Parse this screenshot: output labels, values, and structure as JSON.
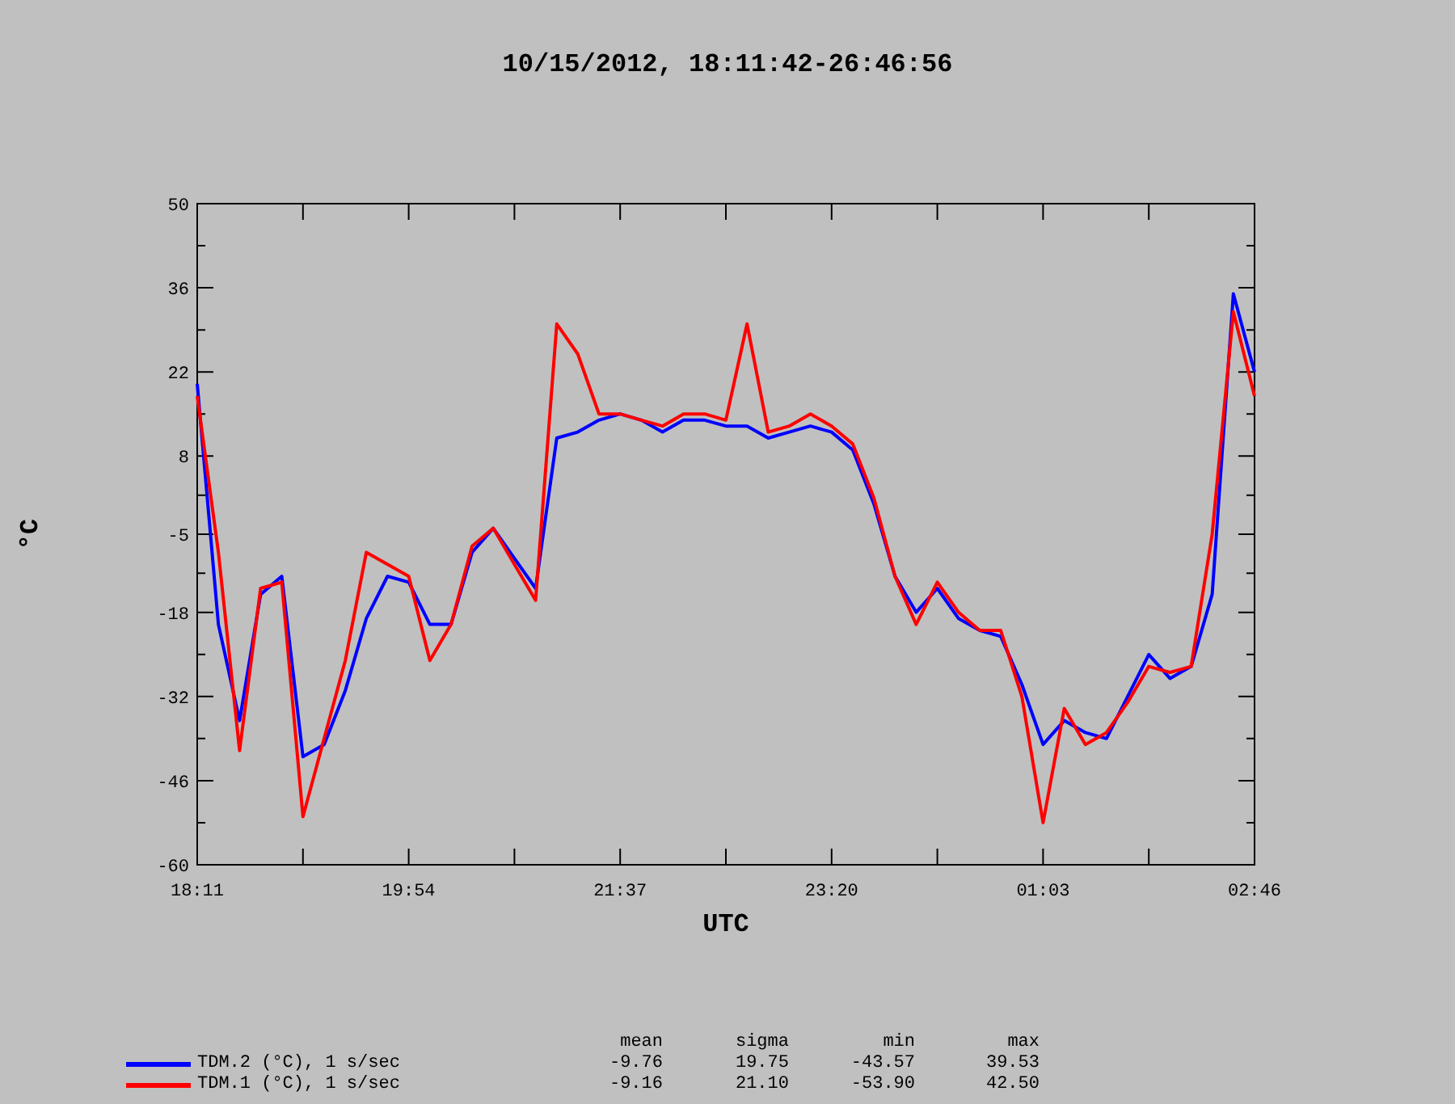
{
  "title": "10/15/2012, 18:11:42-26:46:56",
  "chart_data": {
    "type": "line",
    "xlabel": "UTC",
    "ylabel": "°C",
    "ylim": [
      -60,
      50
    ],
    "yticks": [
      -60,
      -46,
      -32,
      -18,
      -5,
      8,
      22,
      36,
      50
    ],
    "categories": [
      "18:11",
      null,
      null,
      null,
      null,
      null,
      null,
      null,
      null,
      null,
      "19:54",
      null,
      null,
      null,
      null,
      null,
      null,
      null,
      null,
      null,
      "21:37",
      null,
      null,
      null,
      null,
      null,
      null,
      null,
      null,
      null,
      "23:20",
      null,
      null,
      null,
      null,
      null,
      null,
      null,
      null,
      null,
      "01:03",
      null,
      null,
      null,
      null,
      null,
      null,
      null,
      null,
      null,
      "02:46"
    ],
    "series": [
      {
        "name": "TDM.2 (°C), 1 s/sec",
        "color": "#0000ff",
        "values": [
          20,
          -20,
          -36,
          -15,
          -12,
          -42,
          -40,
          -31,
          -19,
          -12,
          -13,
          -20,
          -20,
          -8,
          -4,
          -9,
          -14,
          11,
          12,
          14,
          15,
          14,
          12,
          14,
          14,
          13,
          13,
          11,
          12,
          13,
          12,
          9,
          0,
          -12,
          -18,
          -14,
          -19,
          -21,
          -22,
          -30,
          -40,
          -36,
          -38,
          -39,
          -32,
          -25,
          -29,
          -27,
          -15,
          35,
          22
        ]
      },
      {
        "name": "TDM.1 (°C), 1 s/sec",
        "color": "#ff0000",
        "values": [
          18,
          -8,
          -41,
          -14,
          -13,
          -52,
          -39,
          -26,
          -8,
          -10,
          -12,
          -26,
          -20,
          -7,
          -4,
          -10,
          -16,
          30,
          25,
          15,
          15,
          14,
          13,
          15,
          15,
          14,
          30,
          12,
          13,
          15,
          13,
          10,
          1,
          -12,
          -20,
          -13,
          -18,
          -21,
          -21,
          -32,
          -53,
          -34,
          -40,
          -38,
          -33,
          -27,
          -28,
          -27,
          -5,
          32,
          18
        ]
      }
    ]
  },
  "legend": {
    "columns": [
      "mean",
      "sigma",
      "min",
      "max"
    ],
    "rows": [
      {
        "mean": "-9.76",
        "sigma": "19.75",
        "min": "-43.57",
        "max": "39.53"
      },
      {
        "mean": "-9.16",
        "sigma": "21.10",
        "min": "-53.90",
        "max": "42.50"
      }
    ]
  }
}
